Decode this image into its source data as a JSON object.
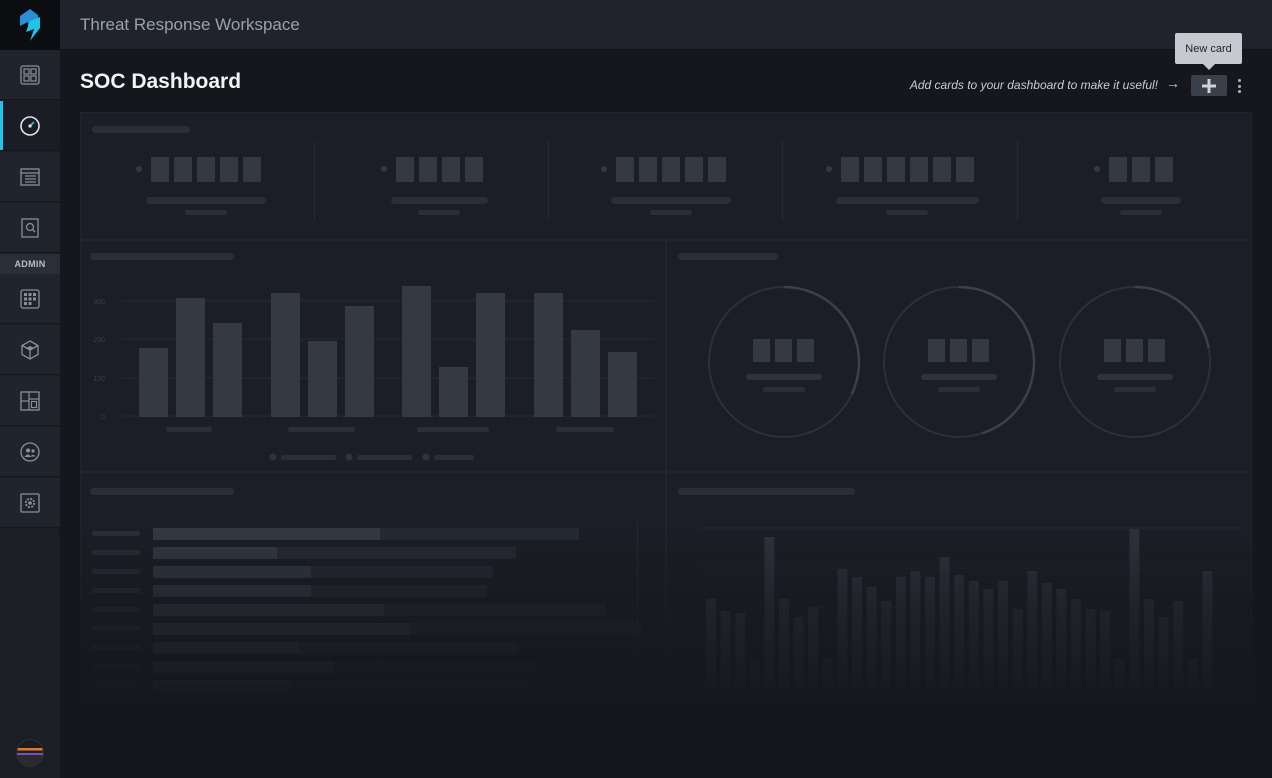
{
  "app": {
    "workspace_title": "Threat Response Workspace"
  },
  "sidebar": {
    "admin_label": "ADMIN",
    "items": [
      {
        "name": "dashboards-grid-icon"
      },
      {
        "name": "gauge-icon",
        "active": true
      },
      {
        "name": "incidents-list-icon"
      },
      {
        "name": "search-report-icon"
      },
      {
        "name": "apps-grid-icon"
      },
      {
        "name": "cube-icon"
      },
      {
        "name": "layout-icon"
      },
      {
        "name": "users-icon"
      },
      {
        "name": "gear-icon"
      }
    ]
  },
  "header": {
    "page_title": "SOC Dashboard",
    "hint": "Add cards to your dashboard to make it useful!",
    "arrow": "→",
    "tooltip": "New card"
  },
  "placeholder_chart": {
    "y_ticks": [
      "300",
      "200",
      "100",
      "0"
    ]
  },
  "colors": {
    "accent": "#20c4e6",
    "background": "#15171c",
    "panel": "#1b1e26",
    "skeleton": "#333843"
  }
}
